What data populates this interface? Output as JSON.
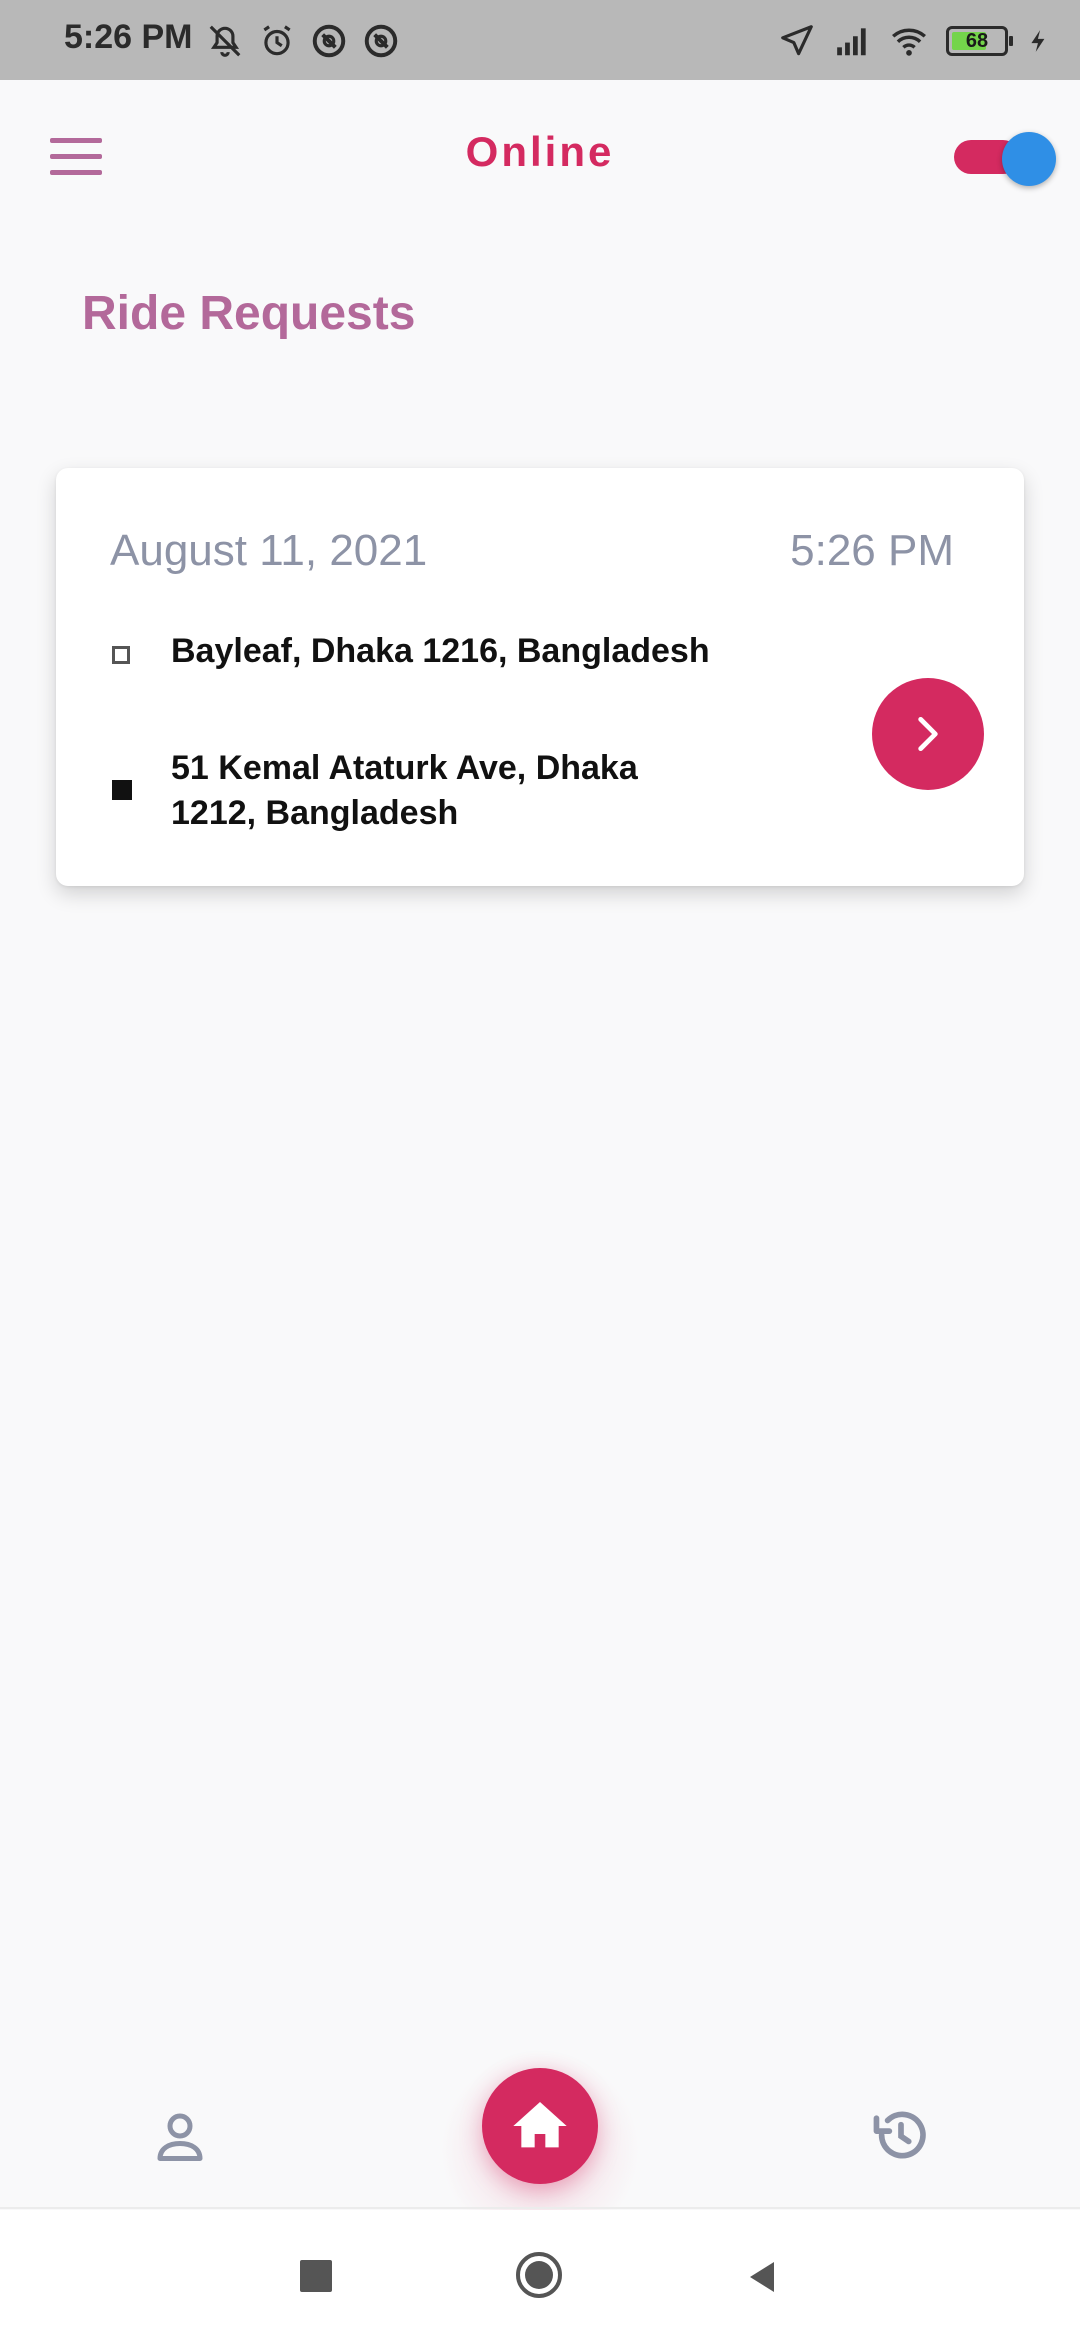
{
  "status_bar": {
    "time": "5:26 PM",
    "left_icons": [
      "muted-bell-icon",
      "alarm-icon",
      "at-sign-icon",
      "at-sign-icon"
    ],
    "right_icons": [
      "location-arrow-icon",
      "signal-icon",
      "wifi-icon",
      "battery-icon",
      "charging-icon"
    ],
    "battery_level": "68",
    "battery_fraction": 0.68
  },
  "app_bar": {
    "title": "Online",
    "menu_icon": "hamburger-menu-icon",
    "online_toggle": true
  },
  "section_title": "Ride Requests",
  "ride_requests": [
    {
      "date": "August 11, 2021",
      "time": "5:26 PM",
      "pickup": "Bayleaf, Dhaka 1216, Bangladesh",
      "dropoff": "51 Kemal Ataturk Ave, Dhaka 1212, Bangladesh"
    }
  ],
  "bottom_nav": {
    "items": [
      "profile-icon",
      "home-icon",
      "history-icon"
    ],
    "active": "home-icon"
  },
  "colors": {
    "accent": "#d42a60",
    "heading": "#b3699a",
    "toggle_thumb": "#2f8fe6",
    "muted_text": "#8d93a6"
  }
}
